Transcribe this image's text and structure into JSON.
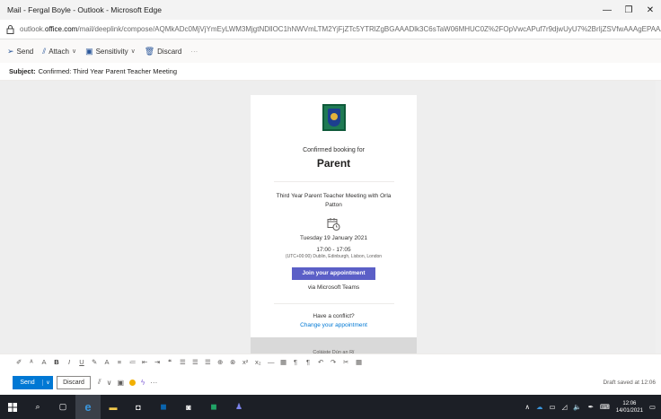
{
  "window": {
    "title": "Mail - Fergal Boyle - Outlook - Microsoft Edge",
    "minimize": "—",
    "restore": "❐",
    "close": "✕"
  },
  "address": {
    "prefix": "outlook.",
    "domain": "office.com",
    "path": "/mail/deeplink/compose/AQMkADc0MjVjYmEyLWM3MjgtNDllOC1hNWVmLTM2YjFjZTc5YTRlZgBGAAADlk3C6sTaW06MHUC0Z%2FOpVwcAPuf7r9djwUyU7%2BrIjZSVfwAAAgEPAAAAPuf7r9djwUyU"
  },
  "commands": {
    "send": "Send",
    "attach": "Attach",
    "sensitivity": "Sensitivity",
    "discard": "Discard",
    "more": "···"
  },
  "subject": {
    "label": "Subject:",
    "value": "Confirmed: Third Year Parent Teacher Meeting"
  },
  "booking": {
    "confirmed_text": "Confirmed booking for",
    "role": "Parent",
    "meeting_title": "Third Year Parent Teacher Meeting with Orla Patton",
    "date": "Tuesday 19 January 2021",
    "time": "17:00 - 17:05",
    "timezone": "(UTC+00:00) Dublin, Edinburgh, Lisbon, London",
    "join_label": "Join your appointment",
    "via": "via Microsoft Teams",
    "conflict": "Have a conflict?",
    "change_link": "Change your appointment",
    "footer": "Coláiste Dún an Rí"
  },
  "format_toolbar": [
    "✐",
    "ᴬ",
    "A",
    "B",
    "I",
    "U",
    "✎",
    "A",
    "≡",
    "≔",
    "⇤",
    "⇥",
    "❝",
    "☰",
    "☰",
    "☰",
    "⊕",
    "⊗",
    "x²",
    "x₂",
    "—",
    "▦",
    "¶",
    "¶",
    "↶",
    "↷",
    "✂",
    "▦"
  ],
  "send_bar": {
    "send": "Send",
    "discard": "Discard",
    "more": "···",
    "draft_status": "Draft saved at 12:06"
  },
  "taskbar": {
    "time": "12:06",
    "date": "14/01/2021"
  },
  "colors": {
    "accent": "#0078d4",
    "teams_button": "#5b5fc7",
    "taskbar": "#1c1f26"
  }
}
